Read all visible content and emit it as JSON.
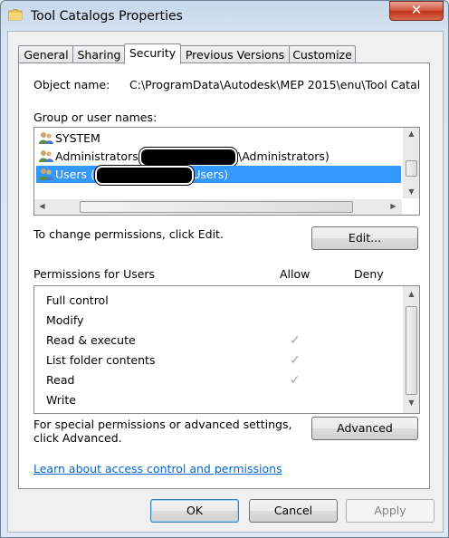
{
  "window": {
    "title": "Tool Catalogs Properties",
    "close_label": "✕"
  },
  "tabs": [
    {
      "label": "General"
    },
    {
      "label": "Sharing"
    },
    {
      "label": "Security"
    },
    {
      "label": "Previous Versions"
    },
    {
      "label": "Customize"
    }
  ],
  "object": {
    "label": "Object name:",
    "value": "C:\\ProgramData\\Autodesk\\MEP 2015\\enu\\Tool Catalc"
  },
  "groups": {
    "label": "Group or user names:",
    "items": [
      {
        "label": "SYSTEM"
      },
      {
        "label": "Administrators (",
        "suffix": "\\Administrators)"
      },
      {
        "label": "Users (",
        "suffix": "\\Users)"
      }
    ]
  },
  "edit": {
    "hint": "To change permissions, click Edit.",
    "button": "Edit..."
  },
  "permissions": {
    "header": "Permissions for Users",
    "allow": "Allow",
    "deny": "Deny",
    "rows": [
      {
        "label": "Full control",
        "allow": false
      },
      {
        "label": "Modify",
        "allow": false
      },
      {
        "label": "Read & execute",
        "allow": true
      },
      {
        "label": "List folder contents",
        "allow": true
      },
      {
        "label": "Read",
        "allow": true
      },
      {
        "label": "Write",
        "allow": false
      }
    ],
    "check_glyph": "✓"
  },
  "advanced": {
    "hint_line1": "For special permissions or advanced settings,",
    "hint_line2": "click Advanced.",
    "button": "Advanced"
  },
  "link": "Learn about access control and permissions",
  "footer": {
    "ok": "OK",
    "cancel": "Cancel",
    "apply": "Apply"
  }
}
